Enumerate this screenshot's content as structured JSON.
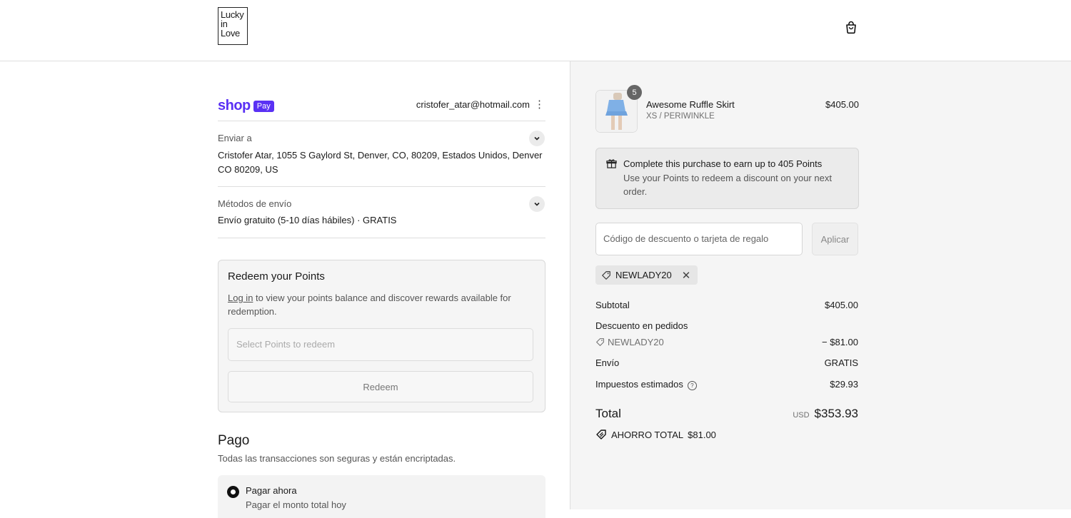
{
  "header": {
    "logo_lines": [
      "Lucky",
      "in",
      "Love"
    ]
  },
  "left": {
    "shoppay_word": "shop",
    "shoppay_badge": "Pay",
    "email": "cristofer_atar@hotmail.com",
    "kebab": "⋮",
    "ship_to_label": "Enviar a",
    "ship_to_value": "Cristofer Atar, 1055 S Gaylord St, Denver, CO, 80209, Estados Unidos, Denver CO 80209, US",
    "ship_method_label": "Métodos de envío",
    "ship_method_value": "Envío gratuito (5-10 días hábiles) · GRATIS",
    "redeem": {
      "title": "Redeem your Points",
      "login_link": "Log in",
      "desc_rest": " to view your points balance and discover rewards available for redemption.",
      "select_placeholder": "Select Points to redeem",
      "button": "Redeem"
    },
    "payment": {
      "title": "Pago",
      "subtitle": "Todas las transacciones son seguras y están encriptadas.",
      "option_label": "Pagar ahora",
      "option_sub": "Pagar el monto total hoy"
    }
  },
  "right": {
    "product": {
      "quantity": "5",
      "name": "Awesome Ruffle Skirt",
      "variant": "XS / PERIWINKLE",
      "price": "$405.00"
    },
    "points": {
      "title": "Complete this purchase to earn up to 405 Points",
      "desc": "Use your Points to redeem a discount on your next order."
    },
    "discount": {
      "placeholder": "Código de descuento o tarjeta de regalo",
      "apply": "Aplicar",
      "chip": "NEWLADY20",
      "chip_close": "✕"
    },
    "summary": {
      "subtotal_label": "Subtotal",
      "subtotal_value": "$405.00",
      "discount_label": "Descuento en pedidos",
      "discount_code": "NEWLADY20",
      "discount_value": "− $81.00",
      "shipping_label": "Envío",
      "shipping_value": "GRATIS",
      "tax_label": "Impuestos estimados",
      "tax_help": "?",
      "tax_value": "$29.93",
      "total_label": "Total",
      "total_currency": "USD",
      "total_value": "$353.93",
      "savings_label": "AHORRO TOTAL",
      "savings_value": "$81.00"
    }
  },
  "colors": {
    "shoppay_purple": "#5a31f4",
    "summary_bg": "#f5f5f5",
    "product_blue": "#7fb0e6"
  },
  "icons": [
    "shopping-bag-icon",
    "chevron-down-icon",
    "gift-icon",
    "tag-icon",
    "close-icon",
    "help-icon",
    "savings-tag-icon",
    "radio-selected-icon"
  ]
}
